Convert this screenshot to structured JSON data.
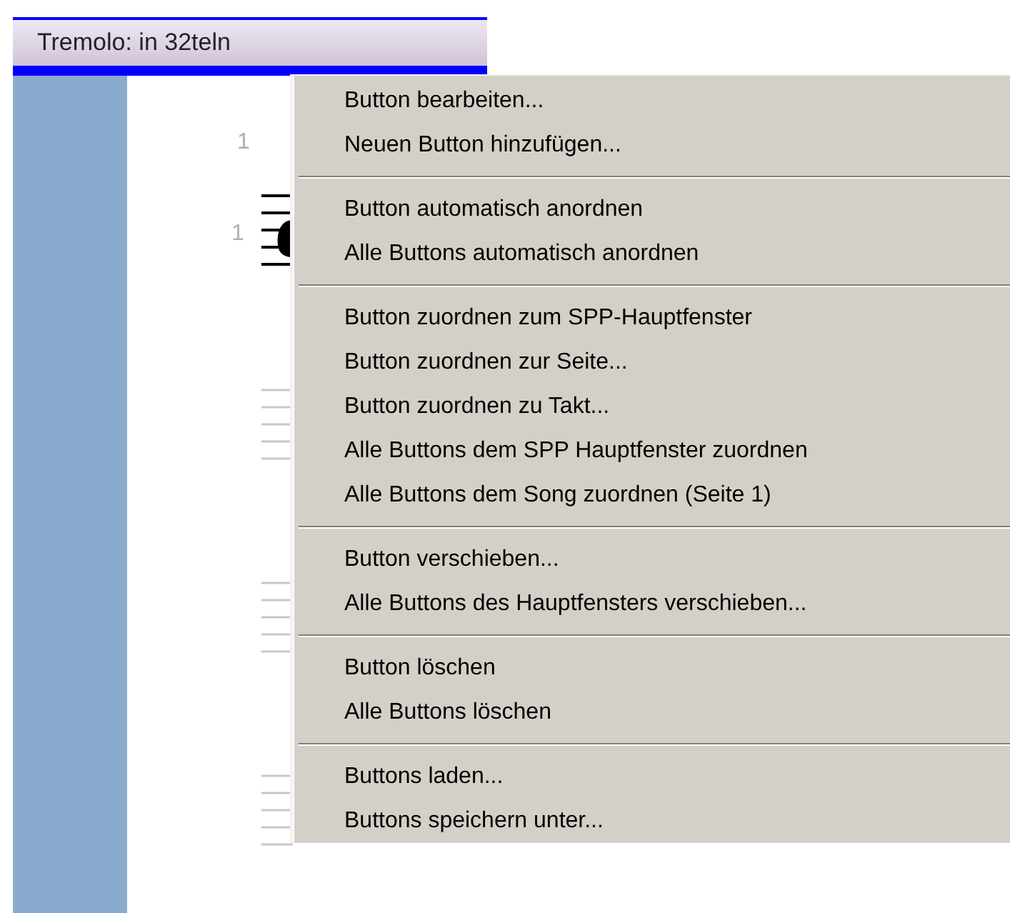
{
  "toolbar_button": {
    "label": "Tremolo: in 32teln"
  },
  "score": {
    "numbers": [
      "1",
      "1"
    ]
  },
  "context_menu": {
    "groups": [
      {
        "items": [
          "Button bearbeiten...",
          "Neuen Button hinzufügen..."
        ]
      },
      {
        "items": [
          "Button automatisch anordnen",
          "Alle Buttons automatisch anordnen"
        ]
      },
      {
        "items": [
          "Button zuordnen zum SPP-Hauptfenster",
          "Button zuordnen zur Seite...",
          "Button zuordnen zu Takt...",
          "Alle Buttons dem SPP Hauptfenster zuordnen",
          "Alle Buttons dem Song zuordnen (Seite 1)"
        ]
      },
      {
        "items": [
          "Button verschieben...",
          "Alle Buttons des Hauptfensters verschieben..."
        ]
      },
      {
        "items": [
          "Button löschen",
          "Alle Buttons löschen"
        ]
      },
      {
        "items": [
          "Buttons laden...",
          "Buttons speichern unter..."
        ]
      }
    ]
  }
}
